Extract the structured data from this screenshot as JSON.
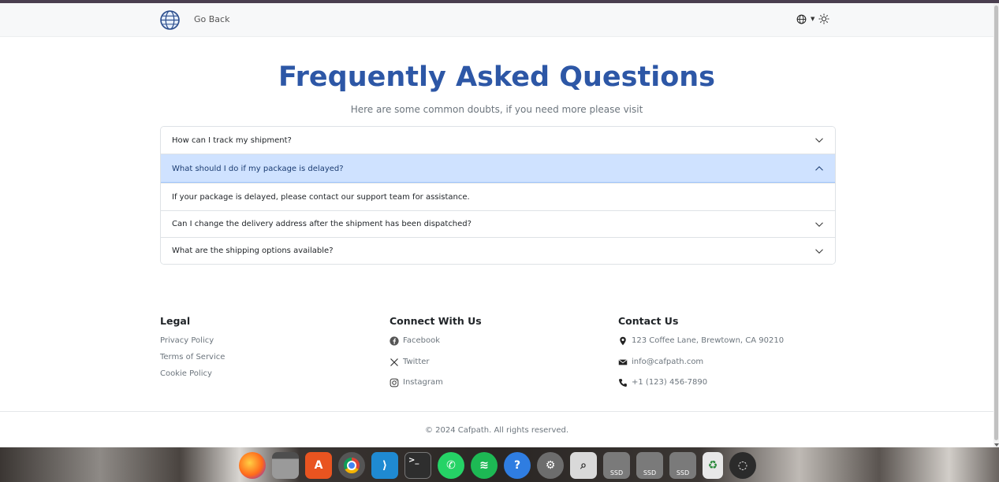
{
  "nav": {
    "back_label": "Go Back"
  },
  "faq": {
    "title": "Frequently Asked Questions",
    "subtitle": "Here are some common doubts, if you need more please visit",
    "items": [
      {
        "question": "How can I track my shipment?",
        "expanded": false
      },
      {
        "question": "What should I do if my package is delayed?",
        "expanded": true,
        "answer": "If your package is delayed, please contact our support team for assistance."
      },
      {
        "question": "Can I change the delivery address after the shipment has been dispatched?",
        "expanded": false
      },
      {
        "question": "What are the shipping options available?",
        "expanded": false
      }
    ]
  },
  "footer": {
    "legal": {
      "heading": "Legal",
      "links": [
        "Privacy Policy",
        "Terms of Service",
        "Cookie Policy"
      ]
    },
    "connect": {
      "heading": "Connect With Us",
      "links": [
        {
          "label": "Facebook",
          "icon": "facebook-icon"
        },
        {
          "label": "Twitter",
          "icon": "x-twitter-icon"
        },
        {
          "label": "Instagram",
          "icon": "instagram-icon"
        }
      ]
    },
    "contact": {
      "heading": "Contact Us",
      "items": [
        {
          "label": "123 Coffee Lane, Brewtown, CA 90210",
          "icon": "location-pin-icon"
        },
        {
          "label": "info@cafpath.com",
          "icon": "envelope-icon"
        },
        {
          "label": "+1 (123) 456-7890",
          "icon": "phone-icon"
        }
      ]
    },
    "copyright": "© 2024 Cafpath. All rights reserved."
  },
  "dock": {
    "apps": [
      "firefox",
      "files",
      "app-center",
      "chrome",
      "vscode",
      "terminal",
      "whatsapp",
      "spotify",
      "help",
      "settings",
      "image-viewer",
      "ssd-drive",
      "ssd-drive",
      "ssd-drive",
      "trash",
      "ubuntu-apps"
    ],
    "ssd_label": "SSD"
  },
  "colors": {
    "title": "#2d57a6",
    "accordion_open_bg": "#cfe2ff",
    "text_muted": "#6c757d"
  }
}
